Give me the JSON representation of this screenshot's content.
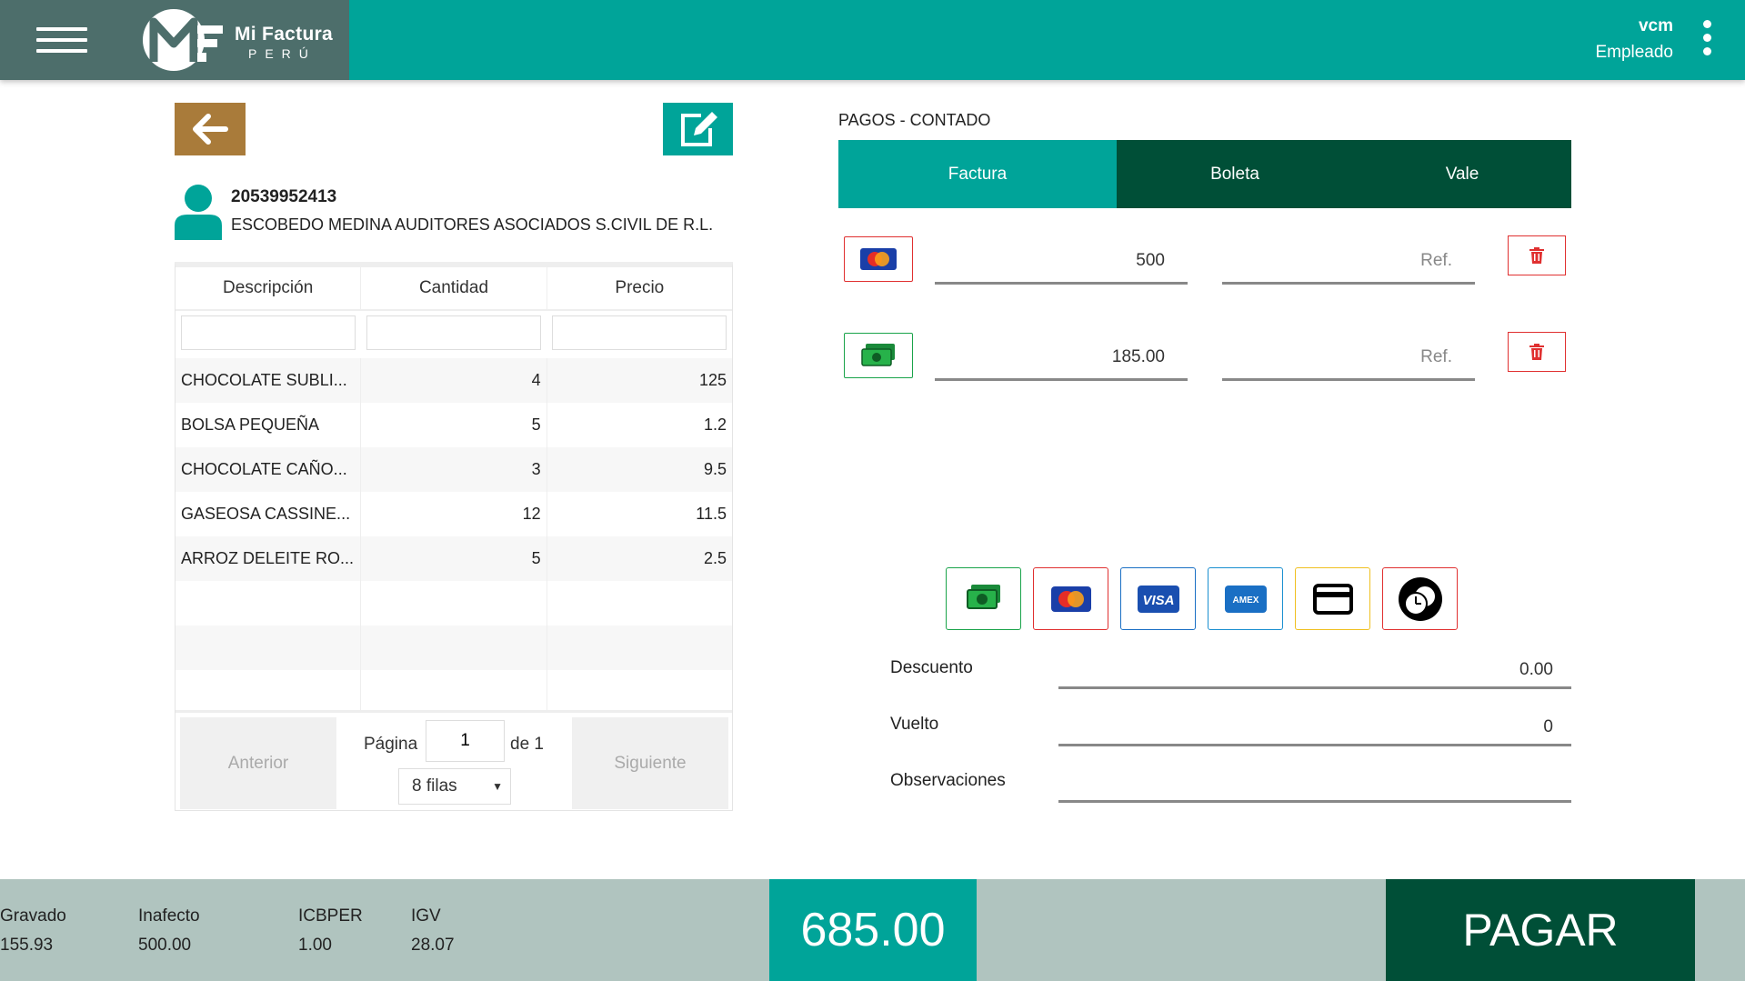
{
  "header": {
    "brand_line1": "Mi Factura",
    "brand_line2": "PERÚ",
    "user_name": "vcm",
    "user_role": "Empleado"
  },
  "client": {
    "ruc": "20539952413",
    "name": "ESCOBEDO MEDINA AUDITORES ASOCIADOS S.CIVIL DE R.L."
  },
  "grid": {
    "columns": [
      "Descripción",
      "Cantidad",
      "Precio"
    ],
    "rows": [
      {
        "description": "CHOCOLATE SUBLI...",
        "quantity": "4",
        "price": "125"
      },
      {
        "description": "BOLSA PEQUEÑA",
        "quantity": "5",
        "price": "1.2"
      },
      {
        "description": "CHOCOLATE CAÑO...",
        "quantity": "3",
        "price": "9.5"
      },
      {
        "description": "GASEOSA CASSINE...",
        "quantity": "12",
        "price": "11.5"
      },
      {
        "description": "ARROZ DELEITE RO...",
        "quantity": "5",
        "price": "2.5"
      }
    ],
    "pagination": {
      "prev_label": "Anterior",
      "next_label": "Siguiente",
      "page_label": "Página",
      "page_value": "1",
      "of_label": "de 1",
      "rows_select": "8 filas"
    }
  },
  "payments": {
    "title": "PAGOS - CONTADO",
    "tabs": [
      "Factura",
      "Boleta",
      "Vale"
    ],
    "active_tab": "Factura",
    "rows": [
      {
        "method": "mastercard-icon",
        "amount": "500",
        "ref_placeholder": "Ref."
      },
      {
        "method": "cash-icon",
        "amount": "185.00",
        "ref_placeholder": "Ref."
      }
    ],
    "methods": [
      "cash-icon",
      "mastercard-icon",
      "visa-icon",
      "amex-icon",
      "card-icon",
      "credit-clock-icon"
    ]
  },
  "summary": {
    "descuento_label": "Descuento",
    "descuento_value": "0.00",
    "vuelto_label": "Vuelto",
    "vuelto_value": "0",
    "observaciones_label": "Observaciones",
    "observaciones_value": ""
  },
  "footer": {
    "gravado_label": "Gravado",
    "gravado_value": "155.93",
    "inafecto_label": "Inafecto",
    "inafecto_value": "500.00",
    "icbper_label": "ICBPER",
    "icbper_value": "1.00",
    "igv_label": "IGV",
    "igv_value": "28.07",
    "total": "685.00",
    "pay_label": "PAGAR"
  },
  "colors": {
    "primary": "#00a499",
    "dark_green": "#004f37",
    "brand_box": "#4d6e6b",
    "back_button": "#a97b3a",
    "footer_bg": "#b0c4bf",
    "delete_red": "#e03030"
  }
}
